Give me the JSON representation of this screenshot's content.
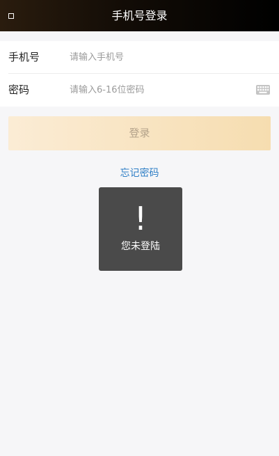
{
  "header": {
    "title": "手机号登录",
    "back_icon": "back-icon"
  },
  "form": {
    "phone": {
      "label": "手机号",
      "value": "",
      "placeholder": "请输入手机号"
    },
    "password": {
      "label": "密码",
      "value": "",
      "placeholder": "请输入6-16位密码",
      "keyboard_icon": "keyboard-icon"
    }
  },
  "login_button": {
    "label": "登录"
  },
  "forgot_password": {
    "label": "忘记密码"
  },
  "toast": {
    "icon": "!",
    "message": "您未登陆"
  },
  "colors": {
    "header_bg": "#000000",
    "page_bg": "#f6f6f8",
    "login_button": "#f6ddb0",
    "link": "#2f7fc6",
    "toast_bg": "#4a4a4a"
  }
}
